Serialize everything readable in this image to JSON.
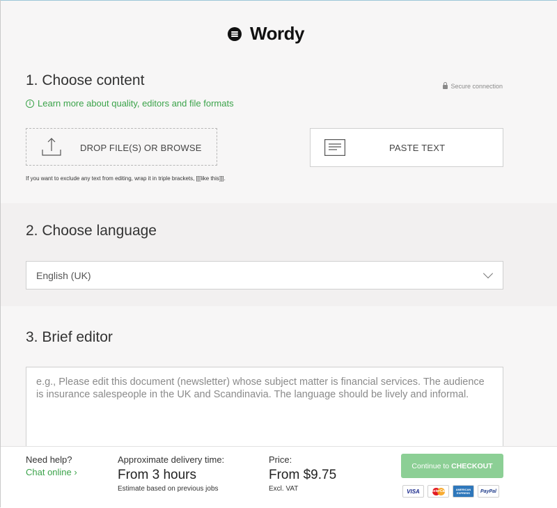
{
  "brand": {
    "name": "Wordy"
  },
  "section1": {
    "title": "1. Choose content",
    "secure_label": "Secure connection",
    "learn_more": "Learn more about quality, editors and file formats",
    "drop_label": "DROP FILE(S) OR BROWSE",
    "paste_label": "PASTE TEXT",
    "exclude_note": "If you want to exclude any text from editing, wrap it in triple brackets, [[[like this]]]."
  },
  "section2": {
    "title": "2. Choose language",
    "selected_language": "English (UK)"
  },
  "section3": {
    "title": "3. Brief editor",
    "placeholder": "e.g., Please edit this document (newsletter) whose subject matter is financial services. The audience is insurance salespeople in the UK and Scandinavia. The language should be lively and informal."
  },
  "footer": {
    "help_label": "Need help?",
    "chat_link": "Chat online ›",
    "delivery_label": "Approximate delivery time:",
    "delivery_value": "From 3 hours",
    "delivery_note": "Estimate based on previous jobs",
    "price_label": "Price:",
    "price_value": "From $9.75",
    "price_note": "Excl. VAT",
    "checkout_prefix": "Continue to",
    "checkout_strong": "CHECKOUT",
    "cards": {
      "visa": "VISA",
      "mastercard": "MasterCard",
      "amex": "AMERICAN EXPRESS",
      "paypal": "PayPal"
    }
  },
  "colors": {
    "accent_green": "#3ba34a",
    "checkout_green": "#8ccf95"
  }
}
